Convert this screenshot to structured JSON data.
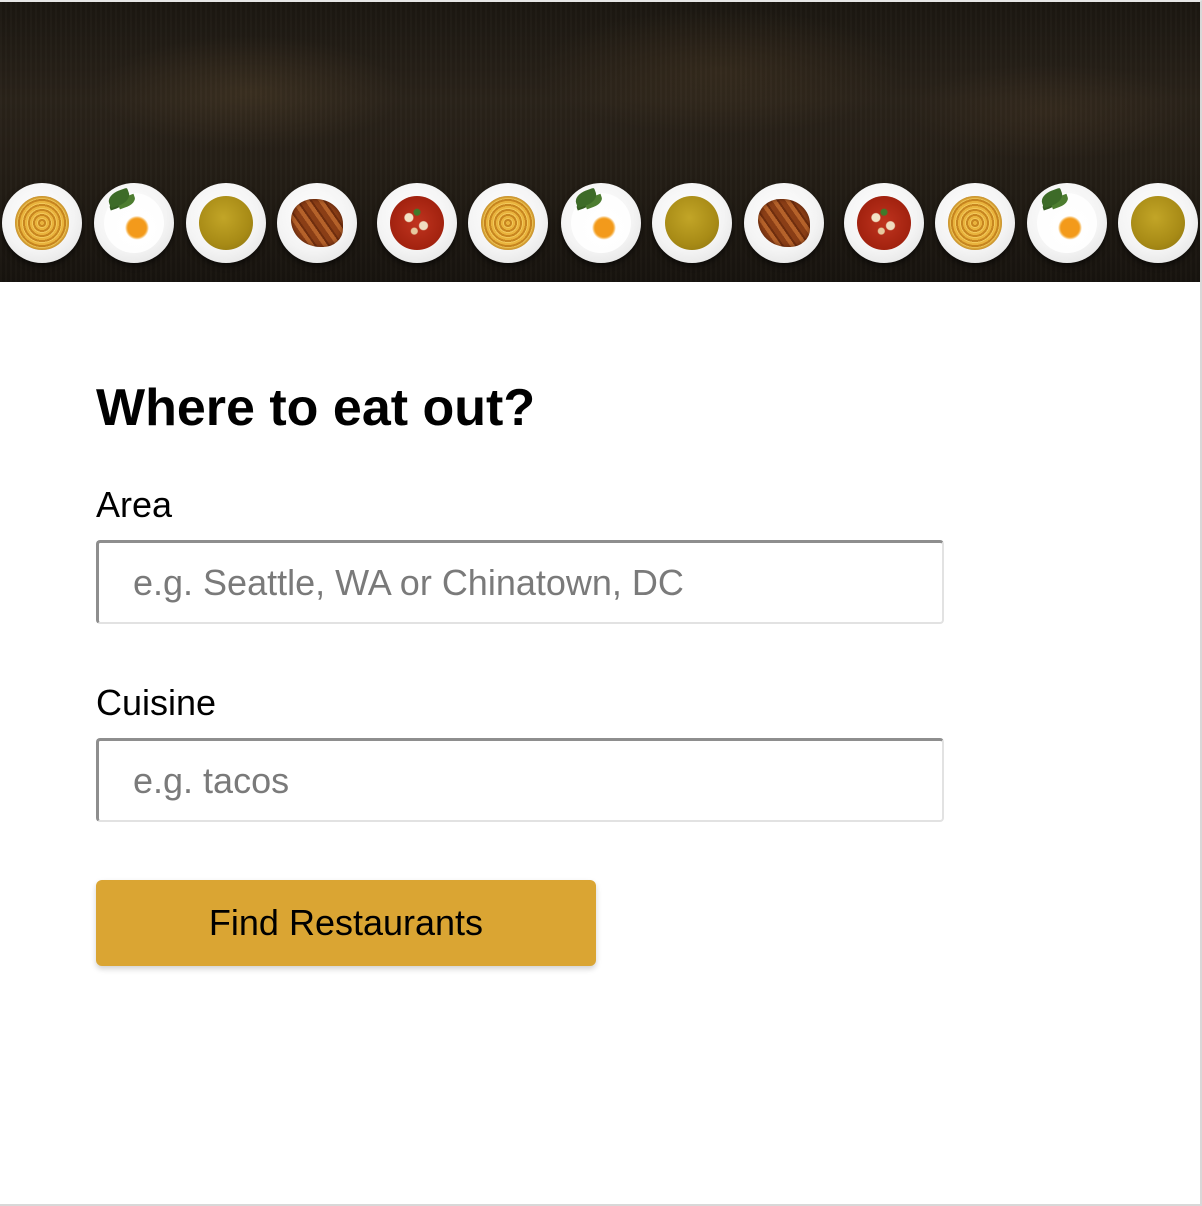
{
  "hero": {
    "plates": [
      "spaghetti",
      "egg",
      "soup",
      "croissant",
      "stew",
      "spaghetti",
      "egg",
      "soup",
      "croissant",
      "stew",
      "spaghetti",
      "egg",
      "soup"
    ]
  },
  "form": {
    "title": "Where to eat out?",
    "area_label": "Area",
    "area_placeholder": "e.g. Seattle, WA or Chinatown, DC",
    "area_value": "",
    "cuisine_label": "Cuisine",
    "cuisine_placeholder": "e.g. tacos",
    "cuisine_value": "",
    "submit_label": "Find Restaurants"
  },
  "colors": {
    "accent": "#daa533",
    "hero_background": "#231d15"
  }
}
